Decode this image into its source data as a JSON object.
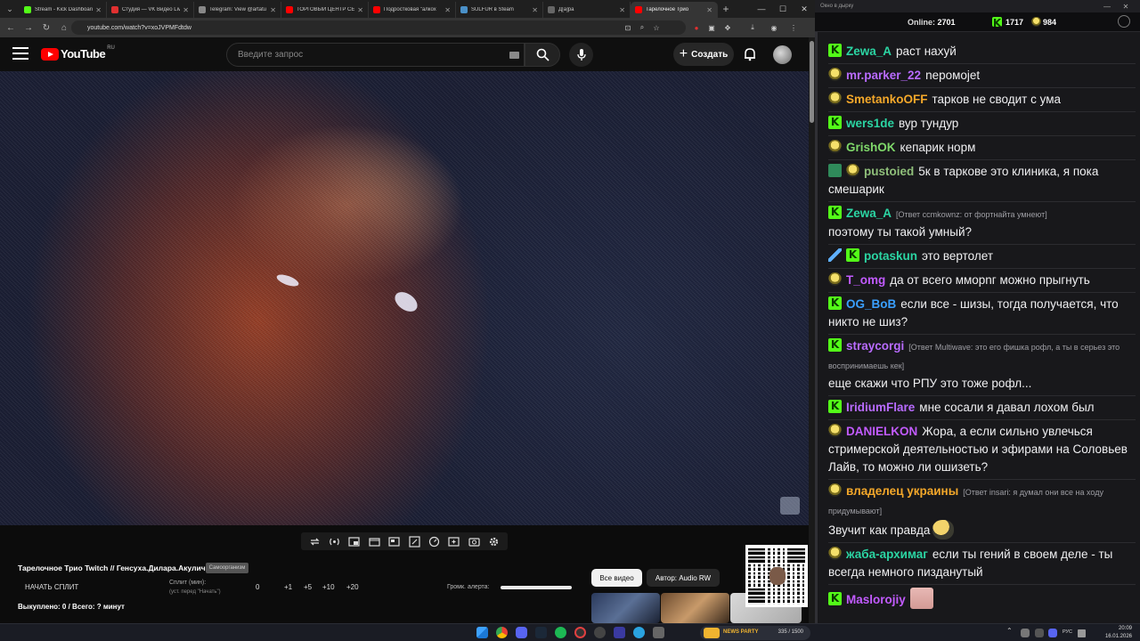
{
  "browser": {
    "tabs": [
      {
        "title": "Stream - Kick Dashboard",
        "color": "#53fc18",
        "active": false
      },
      {
        "title": "Студия — VK Видео Live",
        "color": "#e03030",
        "active": false
      },
      {
        "title": "Telegram: View @artatu",
        "color": "#888888",
        "active": false
      },
      {
        "title": "ТОРГОВЫЙ ЦЕНТР СЕ",
        "color": "#ff0000",
        "active": false
      },
      {
        "title": "Подростковая \"алкох",
        "color": "#ff0000",
        "active": false
      },
      {
        "title": "SULFUR в Steam",
        "color": "#4a90c8",
        "active": false
      },
      {
        "title": "Д[а]ра",
        "color": "#666666",
        "active": false
      },
      {
        "title": "Тарелочное Трио",
        "color": "#ff0000",
        "active": true
      }
    ],
    "url": "youtube.com/watch?v=xoJVPMFdtdw"
  },
  "youtube": {
    "logo_text": "YouTube",
    "region": "RU",
    "search_placeholder": "Введите запрос",
    "create_label": "Создать"
  },
  "panel": {
    "title": "Тарелочное Трио Twitch // Генсуха.Дилара.Акулич",
    "badge": "Самоорганизм",
    "split_start": "НАЧАТЬ СПЛИТ",
    "split_label": "Сплит (мин):",
    "split_hint": "(уст. перед \"Начать\")",
    "split_values": [
      "0",
      "+1",
      "+5",
      "+10",
      "+20"
    ],
    "alert_volume_label": "Громк. алерта:",
    "bought_text": "Выкуплено: 0 / Всего: ? минут",
    "all_videos": "Все видео",
    "author": "Автор: Audio RW"
  },
  "chat": {
    "window_title": "Окно в дырку",
    "online_label": "Online:",
    "online_count": "2701",
    "kick_count": "1717",
    "yellow_count": "984",
    "messages": [
      {
        "badge": "kick",
        "user": "Zewa_A",
        "color": "#2bd5a3",
        "text": "раст нахуй"
      },
      {
        "badge": "yellow",
        "user": "mr.parker_22",
        "color": "#b86bff",
        "text": "neромojet"
      },
      {
        "badge": "yellow",
        "user": "SmetankoOFF",
        "color": "#f4a82a",
        "text": "тарков не сводит с ума"
      },
      {
        "badge": "kick",
        "user": "wers1de",
        "color": "#2bd5a3",
        "text": "вур тундур"
      },
      {
        "badge": "yellow",
        "user": "GrishOK",
        "color": "#7fd86a",
        "text": "кепарик норм"
      },
      {
        "badge": "sub-yellow",
        "user": "pustoied",
        "color": "#8fbf7a",
        "text": "5к в таркове это клиника, я пока смешарик"
      },
      {
        "badge": "kick",
        "user": "Zewa_A",
        "color": "#2bd5a3",
        "reply": "[Ответ ccmkownz: от фортнайта умнеют]",
        "text": "поэтому ты такой умный?"
      },
      {
        "badge": "sword-kick",
        "user": "potaskun",
        "color": "#2bd5a3",
        "text": "это вертолет"
      },
      {
        "badge": "yellow",
        "user": "T_omg",
        "color": "#c25bff",
        "text": "да от всего ммopnг можно прыгнуть"
      },
      {
        "badge": "kick",
        "user": "OG_BoB",
        "color": "#3aa0ff",
        "text": "если все - шизы, тогда получается, что никто не шиз?"
      },
      {
        "badge": "kick",
        "user": "straycorgi",
        "color": "#b86bff",
        "reply": "[Ответ Multiwave: это его фишка рофл, а ты в серьез это воспринимаешь кек]",
        "text": "еще скажи что РПУ это тоже рофл..."
      },
      {
        "badge": "kick",
        "user": "IridiumFlare",
        "color": "#b86bff",
        "text": "мне сосали я давал лохом был"
      },
      {
        "badge": "yellow",
        "user": "DANIELKON",
        "color": "#c25bff",
        "text": "Жора, а если сильно увлечься стримерской деятельностью и эфирами на Соловьев Лайв, то можно ли ошизеть?"
      },
      {
        "badge": "yellow",
        "user": "владелец украины",
        "color": "#f4a82a",
        "reply": "[Ответ insari: я думал они все на ходу придумывают]",
        "text": "Звучит как правда",
        "emote": "dog"
      },
      {
        "badge": "yellow",
        "user": "жаба-архимаг",
        "color": "#2bd5a3",
        "text": "если ты гений в своем деле - ты всегда немного пизданутый"
      },
      {
        "badge": "kick",
        "user": "Maslorojiy",
        "color": "#c25bff",
        "text": "",
        "emote": "pig"
      }
    ]
  },
  "taskbar": {
    "widget_label": "NEWS PARTY",
    "widget_count": "335 / 1500",
    "lang": "РУС",
    "time": "20:09",
    "date": "16.01.2026"
  }
}
